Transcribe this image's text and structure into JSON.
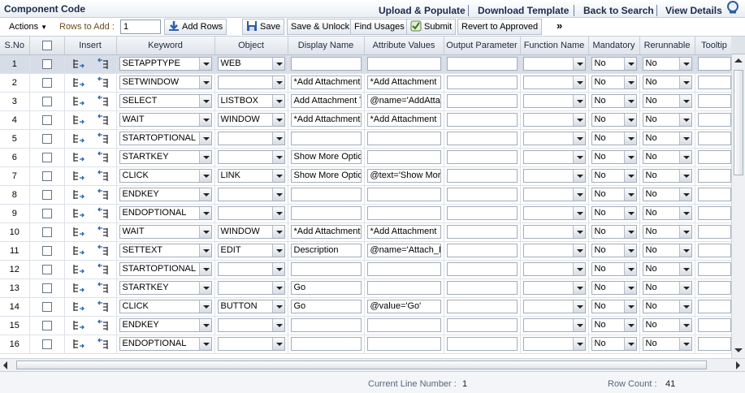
{
  "header": {
    "title": "Component Code",
    "links": [
      "Upload & Populate",
      "Download Template",
      "Back to Search",
      "View Details"
    ]
  },
  "toolbar": {
    "actions_label": "Actions",
    "rows_to_add_label": "Rows to Add :",
    "rows_to_add_value": "1",
    "add_rows": "Add Rows",
    "save": "Save",
    "save_unlock": "Save & Unlock",
    "find_usages": "Find Usages",
    "submit": "Submit",
    "revert": "Revert to Approved",
    "more": "»"
  },
  "columns": [
    "S.No",
    "",
    "Insert",
    "Keyword",
    "Object",
    "Display Name",
    "Attribute Values",
    "Output Parameter",
    "Function Name",
    "Mandatory",
    "Rerunnable",
    "Tooltip"
  ],
  "rows": [
    {
      "sno": "1",
      "keyword": "SETAPPTYPE",
      "object": "WEB",
      "display": "",
      "attr": "",
      "mandatory": "No",
      "rerun": "No"
    },
    {
      "sno": "2",
      "keyword": "SETWINDOW",
      "object": "",
      "display": "*Add Attachment",
      "attr": "*Add Attachment",
      "mandatory": "No",
      "rerun": "No"
    },
    {
      "sno": "3",
      "keyword": "SELECT",
      "object": "LISTBOX",
      "display": "Add Attachment Type",
      "attr": "@name='AddAttachmentType'",
      "mandatory": "No",
      "rerun": "No"
    },
    {
      "sno": "4",
      "keyword": "WAIT",
      "object": "WINDOW",
      "display": "*Add Attachment",
      "attr": "*Add Attachment",
      "mandatory": "No",
      "rerun": "No"
    },
    {
      "sno": "5",
      "keyword": "STARTOPTIONAL",
      "object": "",
      "display": "",
      "attr": "",
      "mandatory": "No",
      "rerun": "No"
    },
    {
      "sno": "6",
      "keyword": "STARTKEY",
      "object": "",
      "display": "Show More Options",
      "attr": "",
      "mandatory": "No",
      "rerun": "No"
    },
    {
      "sno": "7",
      "keyword": "CLICK",
      "object": "LINK",
      "display": "Show More Options",
      "attr": "@text='Show More Options'",
      "mandatory": "No",
      "rerun": "No"
    },
    {
      "sno": "8",
      "keyword": "ENDKEY",
      "object": "",
      "display": "",
      "attr": "",
      "mandatory": "No",
      "rerun": "No"
    },
    {
      "sno": "9",
      "keyword": "ENDOPTIONAL",
      "object": "",
      "display": "",
      "attr": "",
      "mandatory": "No",
      "rerun": "No"
    },
    {
      "sno": "10",
      "keyword": "WAIT",
      "object": "WINDOW",
      "display": "*Add Attachment",
      "attr": "*Add Attachment",
      "mandatory": "No",
      "rerun": "No"
    },
    {
      "sno": "11",
      "keyword": "SETTEXT",
      "object": "EDIT",
      "display": "Description",
      "attr": "@name='Attach_Desc'",
      "mandatory": "No",
      "rerun": "No"
    },
    {
      "sno": "12",
      "keyword": "STARTOPTIONAL",
      "object": "",
      "display": "",
      "attr": "",
      "mandatory": "No",
      "rerun": "No"
    },
    {
      "sno": "13",
      "keyword": "STARTKEY",
      "object": "",
      "display": "Go",
      "attr": "",
      "mandatory": "No",
      "rerun": "No"
    },
    {
      "sno": "14",
      "keyword": "CLICK",
      "object": "BUTTON",
      "display": "Go",
      "attr": "@value='Go'",
      "mandatory": "No",
      "rerun": "No"
    },
    {
      "sno": "15",
      "keyword": "ENDKEY",
      "object": "",
      "display": "",
      "attr": "",
      "mandatory": "No",
      "rerun": "No"
    },
    {
      "sno": "16",
      "keyword": "ENDOPTIONAL",
      "object": "",
      "display": "",
      "attr": "",
      "mandatory": "No",
      "rerun": "No"
    }
  ],
  "status": {
    "line_label": "Current Line Number :",
    "line_value": "1",
    "count_label": "Row Count :",
    "count_value": "41"
  }
}
